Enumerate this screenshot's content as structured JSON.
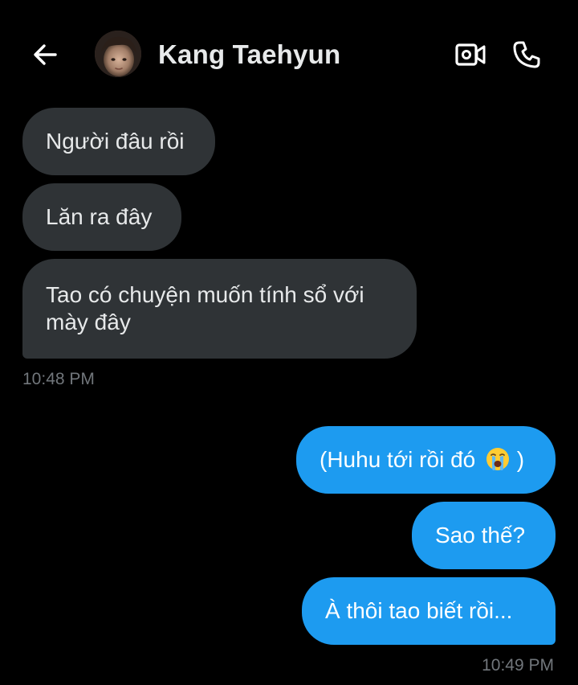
{
  "header": {
    "contact_name": "Kang Taehyun",
    "icons": {
      "back": "arrow-left-icon",
      "video": "video-camera-icon",
      "call": "phone-icon"
    }
  },
  "colors": {
    "background": "#000000",
    "incoming_bubble": "#2f3336",
    "outgoing_bubble": "#1d9bf0",
    "timestamp_text": "#71767b"
  },
  "messages": {
    "incoming": [
      {
        "text": "Người đâu rồi"
      },
      {
        "text": "Lăn ra đây"
      },
      {
        "text": "Tao có chuyện muốn tính sổ với mày đây"
      }
    ],
    "incoming_time": "10:48 PM",
    "outgoing": [
      {
        "text": "(Huhu tới rồi đó",
        "text_after": ")",
        "emoji": "loudly-crying-face-icon"
      },
      {
        "text": "Sao thế?"
      },
      {
        "text": "À thôi tao biết rồi..."
      }
    ],
    "outgoing_time": "10:49 PM"
  }
}
